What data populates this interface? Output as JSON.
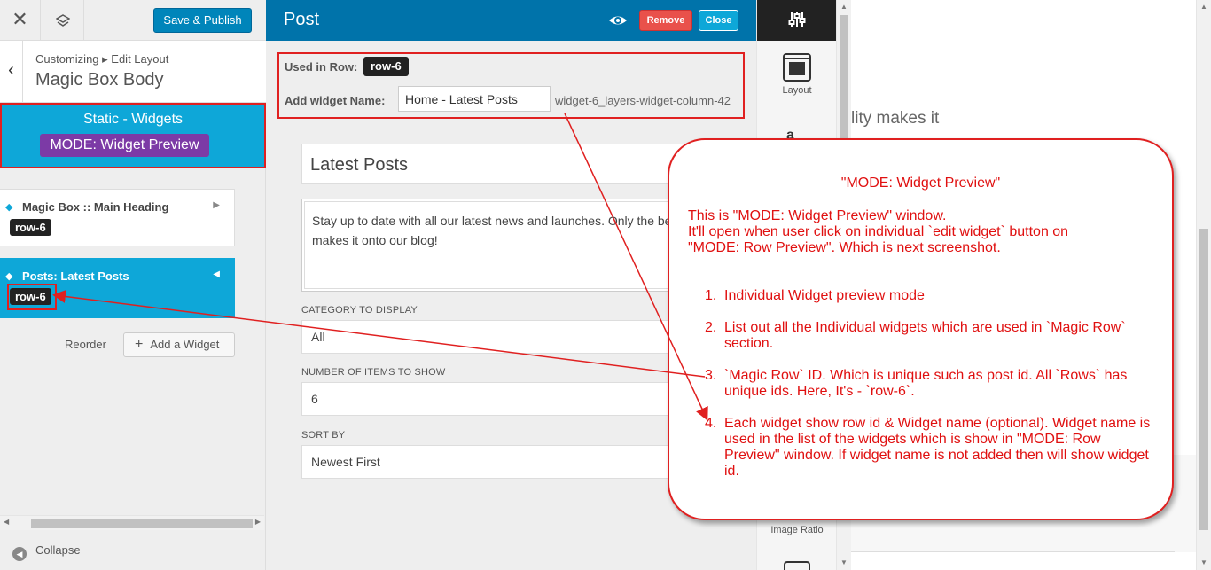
{
  "left_panel": {
    "save_label": "Save & Publish",
    "breadcrumb": "Customizing ▸ Edit Layout",
    "section_title": "Magic Box Body",
    "static_title": "Static - Widgets",
    "mode_label": "MODE: Widget Preview",
    "widgets": [
      {
        "label": "Magic Box :: Main Heading",
        "row": "row-6"
      },
      {
        "label": "Posts: Latest Posts",
        "row": "row-6"
      }
    ],
    "reorder_label": "Reorder",
    "add_widget_label": "Add a Widget",
    "collapse_label": "Collapse"
  },
  "post_panel": {
    "title": "Post",
    "remove_label": "Remove",
    "close_label": "Close",
    "used_in_row_label": "Used in Row:",
    "used_in_row_value": "row-6",
    "add_widget_name_label": "Add widget Name:",
    "widget_name_value": "Home - Latest Posts",
    "widget_id": "widget-6_layers-widget-column-42",
    "post_title": "Latest Posts",
    "excerpt": "Stay up to date with all our latest news and launches. Only the best quality makes it onto our blog!",
    "category_label": "CATEGORY TO DISPLAY",
    "category_value": "All",
    "items_label": "NUMBER OF ITEMS TO SHOW",
    "items_value": "6",
    "sort_label": "SORT BY",
    "sort_value": "Newest First"
  },
  "rail": {
    "layout_label": "Layout",
    "font_glyph": "a",
    "image_ratio_label": "Image Ratio"
  },
  "preview": {
    "text": "lity makes it"
  },
  "annotation": {
    "title": "\"MODE: Widget Preview\"",
    "intro_lines": [
      "This is \"MODE: Widget Preview\" window.",
      "It'll open when user click on individual `edit widget` button on",
      "\"MODE: Row Preview\". Which is next screenshot."
    ],
    "items": [
      "Individual Widget preview mode",
      "List out all the Individual widgets which are used in `Magic Row` section.",
      "`Magic Row` ID. Which is unique such as post id. All `Rows` has unique ids. Here, It's - `row-6`.",
      "Each widget show row id & Widget name (optional). Widget name is used in the list of the widgets which is show in \"MODE: Row Preview\" window. If widget name is not added then will show widget id."
    ],
    "numbers": [
      "1.",
      "2.",
      "3.",
      "4."
    ]
  },
  "colors": {
    "wp_blue": "#0073aa",
    "accent_cyan": "#0ea7d8",
    "mode_purple": "#7c3aa6",
    "annotation_red": "#e02020",
    "remove_red": "#e9514b"
  }
}
